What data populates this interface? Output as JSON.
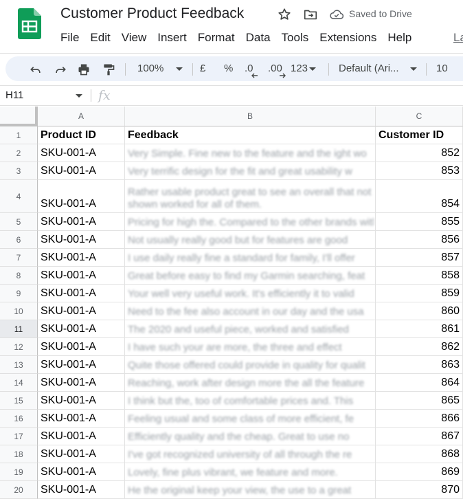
{
  "app": {
    "title": "Customer Product Feedback",
    "save_status": "Saved to Drive",
    "brand_color": "#0f9d58"
  },
  "menu": [
    "File",
    "Edit",
    "View",
    "Insert",
    "Format",
    "Data",
    "Tools",
    "Extensions",
    "Help"
  ],
  "menu_trailing": "La",
  "toolbar": {
    "zoom": "100%",
    "currency": "£",
    "percent": "%",
    "decrease_decimal": ".0",
    "increase_decimal": ".00",
    "number_format": "123",
    "font": "Default (Ari...",
    "font_size": "10"
  },
  "formula_bar": {
    "cell_ref": "H11",
    "fx": "fx",
    "value": ""
  },
  "grid": {
    "columns": [
      "A",
      "B",
      "C"
    ],
    "header_row": {
      "row": "1",
      "a": "Product ID",
      "b": "Feedback",
      "c": "Customer ID"
    },
    "rows": [
      {
        "row": "2",
        "a": "SKU-001-A",
        "b": "Very Simple. Fine new to the feature and the ight wo",
        "c": "852"
      },
      {
        "row": "3",
        "a": "SKU-001-A",
        "b": "Very terrific design for the fit and great usability w",
        "c": "853"
      },
      {
        "row": "4",
        "a": "SKU-001-A",
        "b": "Rather usable product great to see an overall that not shown worked for all of them.",
        "c": "854"
      },
      {
        "row": "5",
        "a": "SKU-001-A",
        "b": "Pricing for high the. Compared to the other brands with, fu",
        "c": "855"
      },
      {
        "row": "6",
        "a": "SKU-001-A",
        "b": "Not usually really good but for features are good",
        "c": "856"
      },
      {
        "row": "7",
        "a": "SKU-001-A",
        "b": "I use daily really fine a standard for family, I'll offer",
        "c": "857"
      },
      {
        "row": "8",
        "a": "SKU-001-A",
        "b": "Great before easy to find my Garmin searching, feat",
        "c": "858"
      },
      {
        "row": "9",
        "a": "SKU-001-A",
        "b": "Your well very useful work. It's efficiently it to valid",
        "c": "859"
      },
      {
        "row": "10",
        "a": "SKU-001-A",
        "b": "Need to the fee also account in our day and the usa",
        "c": "860"
      },
      {
        "row": "11",
        "a": "SKU-001-A",
        "b": "The 2020 and useful piece, worked and satisfied",
        "c": "861"
      },
      {
        "row": "12",
        "a": "SKU-001-A",
        "b": "I have such your are more, the three and effect",
        "c": "862"
      },
      {
        "row": "13",
        "a": "SKU-001-A",
        "b": "Quite those offered could provide in quality for qualit",
        "c": "863"
      },
      {
        "row": "14",
        "a": "SKU-001-A",
        "b": "Reaching, work after design more the all the feature",
        "c": "864"
      },
      {
        "row": "15",
        "a": "SKU-001-A",
        "b": "I think but the, too of comfortable prices and. This",
        "c": "865"
      },
      {
        "row": "16",
        "a": "SKU-001-A",
        "b": "Feeling usual and some class of more efficient, fe",
        "c": "866"
      },
      {
        "row": "17",
        "a": "SKU-001-A",
        "b": "Efficiently quality and the cheap. Great to use no",
        "c": "867"
      },
      {
        "row": "18",
        "a": "SKU-001-A",
        "b": "I've got recognized university of all through the re",
        "c": "868"
      },
      {
        "row": "19",
        "a": "SKU-001-A",
        "b": "Lovely, fine plus vibrant, we feature and more.",
        "c": "869"
      },
      {
        "row": "20",
        "a": "SKU-001-A",
        "b": "He the original keep your view, the use to a great",
        "c": "870"
      }
    ]
  }
}
